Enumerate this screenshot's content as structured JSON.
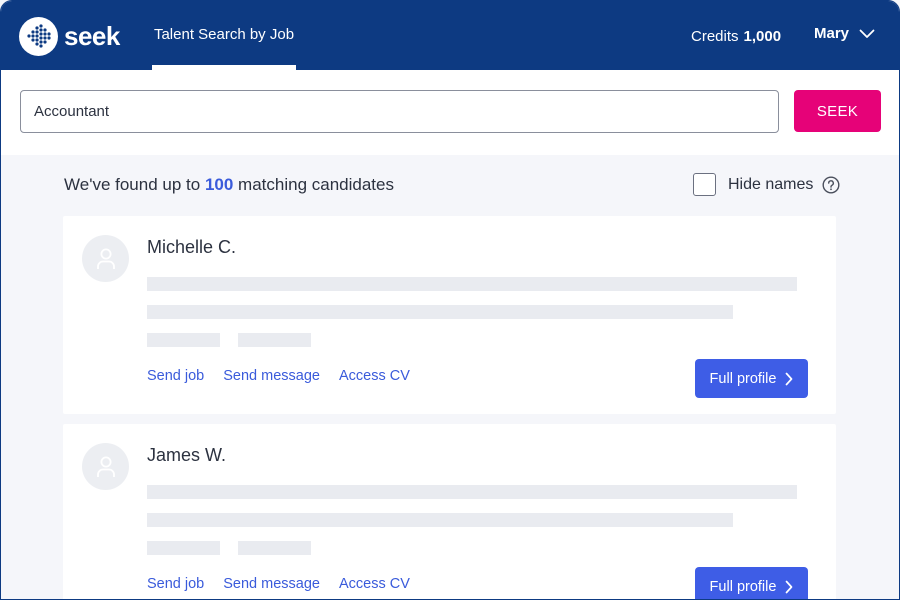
{
  "header": {
    "logo_text": "seek",
    "nav_tab": "Talent Search by Job",
    "credits_label": "Credits",
    "credits_value": "1,000",
    "user_name": "Mary"
  },
  "search": {
    "value": "Accountant",
    "button_label": "SEEK"
  },
  "results": {
    "prefix": "We've found up to",
    "count": "100",
    "suffix": "matching candidates",
    "hide_names_label": "Hide names"
  },
  "candidates": [
    {
      "name": "Michelle C.",
      "actions": [
        "Send job",
        "Send message",
        "Access CV"
      ],
      "profile_label": "Full profile"
    },
    {
      "name": "James W.",
      "actions": [
        "Send job",
        "Send message",
        "Access CV"
      ],
      "profile_label": "Full profile"
    }
  ],
  "icons": {
    "logo": "seek-logo-icon",
    "chevron": "chevron-down-icon",
    "help": "question-circle-icon",
    "avatar": "person-icon",
    "arrow": "chevron-right-icon"
  },
  "colors": {
    "header_bg": "#0d3a82",
    "seek_button": "#e60278",
    "primary_button": "#3e5de6",
    "link": "#3a5bdb"
  }
}
